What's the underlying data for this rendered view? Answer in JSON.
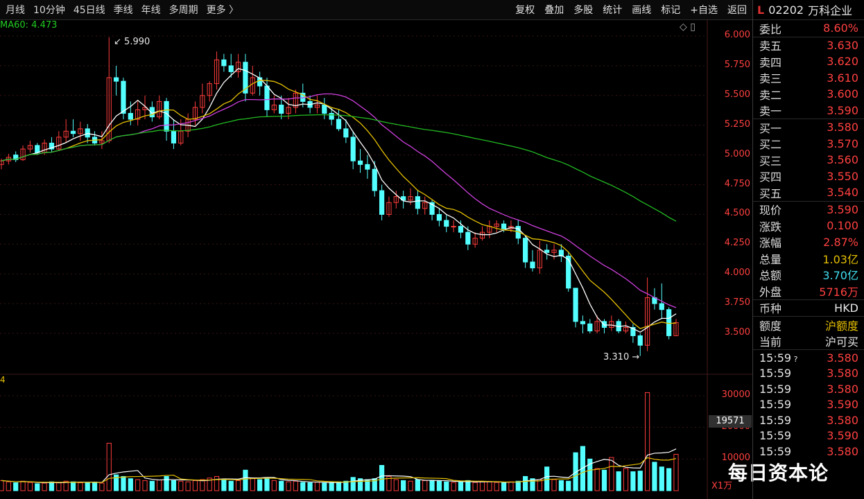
{
  "toolbar": {
    "left_items": [
      "月线",
      "10分钟",
      "45日线",
      "季线",
      "年线",
      "多周期",
      "更多 〉"
    ],
    "right_items": [
      "复权",
      "叠加",
      "多股",
      "统计",
      "画线",
      "标记",
      "+自选",
      "返回"
    ]
  },
  "ma_label": "MA60: 4.473",
  "annotations": {
    "high": "5.990",
    "low": "3.310"
  },
  "watermark": "每日资本论",
  "volume_unit": "X1万",
  "volume_badge": "19571",
  "stock": {
    "code": "02202",
    "name": "万科企业",
    "mark": "L"
  },
  "quote": {
    "weibi": {
      "label": "委比",
      "value": "8.60%"
    },
    "asks": [
      {
        "label": "卖五",
        "value": "3.630"
      },
      {
        "label": "卖四",
        "value": "3.620"
      },
      {
        "label": "卖三",
        "value": "3.610"
      },
      {
        "label": "卖二",
        "value": "3.600"
      },
      {
        "label": "卖一",
        "value": "3.590"
      }
    ],
    "bids": [
      {
        "label": "买一",
        "value": "3.580"
      },
      {
        "label": "买二",
        "value": "3.570"
      },
      {
        "label": "买三",
        "value": "3.560"
      },
      {
        "label": "买四",
        "value": "3.550"
      },
      {
        "label": "买五",
        "value": "3.540"
      }
    ],
    "stats": [
      {
        "label": "现价",
        "value": "3.590",
        "color": "red"
      },
      {
        "label": "涨跌",
        "value": "0.100",
        "color": "red"
      },
      {
        "label": "涨幅",
        "value": "2.87%",
        "color": "red"
      },
      {
        "label": "总量",
        "value": "1.03亿",
        "color": "yellow"
      },
      {
        "label": "总额",
        "value": "3.70亿",
        "color": "cyan"
      },
      {
        "label": "外盘",
        "value": "5716万",
        "color": "red"
      }
    ],
    "currency": {
      "label": "币种",
      "value": "HKD"
    },
    "quota": {
      "label": "额度",
      "value": "沪额度"
    },
    "current": {
      "label": "当前",
      "value": "沪可买"
    }
  },
  "ticks": [
    {
      "time": "15:59",
      "flag": "?",
      "price": "3.580"
    },
    {
      "time": "15:59",
      "flag": "",
      "price": "3.580"
    },
    {
      "time": "15:59",
      "flag": "",
      "price": "3.580"
    },
    {
      "time": "15:59",
      "flag": "",
      "price": "3.590"
    },
    {
      "time": "15:59",
      "flag": "",
      "price": "3.580"
    },
    {
      "time": "15:59",
      "flag": "",
      "price": "3.590"
    },
    {
      "time": "15:59",
      "flag": "",
      "price": "3.580"
    }
  ],
  "chart_data": {
    "type": "candlestick",
    "price_axis": {
      "ticks": [
        "6.000",
        "5.750",
        "5.500",
        "5.250",
        "5.000",
        "4.750",
        "4.500",
        "4.250",
        "4.000",
        "3.750",
        "3.500"
      ],
      "range": [
        3.3,
        6.05
      ]
    },
    "volume_axis": {
      "ticks": [
        "30000",
        "20000",
        "10000"
      ],
      "range": [
        0,
        32000
      ]
    },
    "candles": [
      [
        4.92,
        4.95,
        4.88,
        4.97
      ],
      [
        4.95,
        4.98,
        4.92,
        5.01
      ],
      [
        5.0,
        4.96,
        4.94,
        5.03
      ],
      [
        4.96,
        5.05,
        4.95,
        5.08
      ],
      [
        5.05,
        5.08,
        5.02,
        5.12
      ],
      [
        5.08,
        5.02,
        5.0,
        5.1
      ],
      [
        5.02,
        5.1,
        5.0,
        5.13
      ],
      [
        5.1,
        5.05,
        5.02,
        5.15
      ],
      [
        5.05,
        5.15,
        5.04,
        5.2
      ],
      [
        5.15,
        5.2,
        5.1,
        5.3
      ],
      [
        5.2,
        5.18,
        5.15,
        5.3
      ],
      [
        5.18,
        5.22,
        5.12,
        5.28
      ],
      [
        5.22,
        5.15,
        5.1,
        5.26
      ],
      [
        5.15,
        5.1,
        5.08,
        5.2
      ],
      [
        5.1,
        5.12,
        5.05,
        5.2
      ],
      [
        5.12,
        5.65,
        5.1,
        5.99
      ],
      [
        5.65,
        5.62,
        5.5,
        5.75
      ],
      [
        5.62,
        5.35,
        5.3,
        5.65
      ],
      [
        5.35,
        5.3,
        5.25,
        5.45
      ],
      [
        5.3,
        5.38,
        5.25,
        5.45
      ],
      [
        5.38,
        5.4,
        5.3,
        5.5
      ],
      [
        5.4,
        5.32,
        5.28,
        5.45
      ],
      [
        5.32,
        5.45,
        5.3,
        5.5
      ],
      [
        5.45,
        5.2,
        5.12,
        5.48
      ],
      [
        5.2,
        5.1,
        5.05,
        5.3
      ],
      [
        5.1,
        5.2,
        5.08,
        5.3
      ],
      [
        5.2,
        5.3,
        5.15,
        5.35
      ],
      [
        5.3,
        5.4,
        5.25,
        5.45
      ],
      [
        5.4,
        5.5,
        5.35,
        5.6
      ],
      [
        5.5,
        5.6,
        5.45,
        5.62
      ],
      [
        5.6,
        5.8,
        5.55,
        5.87
      ],
      [
        5.8,
        5.75,
        5.7,
        5.85
      ],
      [
        5.75,
        5.7,
        5.65,
        5.85
      ],
      [
        5.7,
        5.78,
        5.65,
        5.85
      ],
      [
        5.78,
        5.52,
        5.45,
        5.85
      ],
      [
        5.52,
        5.65,
        5.5,
        5.75
      ],
      [
        5.65,
        5.58,
        5.5,
        5.7
      ],
      [
        5.58,
        5.38,
        5.32,
        5.65
      ],
      [
        5.38,
        5.42,
        5.35,
        5.5
      ],
      [
        5.42,
        5.35,
        5.3,
        5.5
      ],
      [
        5.35,
        5.4,
        5.3,
        5.48
      ],
      [
        5.4,
        5.52,
        5.35,
        5.55
      ],
      [
        5.52,
        5.45,
        5.4,
        5.6
      ],
      [
        5.45,
        5.4,
        5.35,
        5.5
      ],
      [
        5.4,
        5.42,
        5.35,
        5.5
      ],
      [
        5.42,
        5.35,
        5.3,
        5.48
      ],
      [
        5.35,
        5.3,
        5.25,
        5.4
      ],
      [
        5.3,
        5.22,
        5.2,
        5.38
      ],
      [
        5.22,
        5.15,
        5.1,
        5.3
      ],
      [
        5.15,
        4.95,
        4.88,
        5.2
      ],
      [
        4.95,
        4.92,
        4.85,
        5.05
      ],
      [
        4.92,
        4.88,
        4.8,
        5.0
      ],
      [
        4.88,
        4.7,
        4.65,
        4.95
      ],
      [
        4.7,
        4.5,
        4.45,
        4.75
      ],
      [
        4.5,
        4.6,
        4.48,
        4.65
      ],
      [
        4.6,
        4.65,
        4.55,
        4.7
      ],
      [
        4.65,
        4.62,
        4.55,
        4.7
      ],
      [
        4.62,
        4.65,
        4.58,
        4.72
      ],
      [
        4.65,
        4.55,
        4.5,
        4.7
      ],
      [
        4.55,
        4.6,
        4.5,
        4.65
      ],
      [
        4.6,
        4.5,
        4.45,
        4.62
      ],
      [
        4.5,
        4.45,
        4.4,
        4.55
      ],
      [
        4.45,
        4.4,
        4.35,
        4.5
      ],
      [
        4.4,
        4.4,
        4.35,
        4.45
      ],
      [
        4.4,
        4.35,
        4.3,
        4.45
      ],
      [
        4.35,
        4.25,
        4.2,
        4.4
      ],
      [
        4.25,
        4.3,
        4.22,
        4.35
      ],
      [
        4.3,
        4.35,
        4.28,
        4.4
      ],
      [
        4.35,
        4.4,
        4.3,
        4.45
      ],
      [
        4.4,
        4.42,
        4.35,
        4.45
      ],
      [
        4.42,
        4.38,
        4.35,
        4.45
      ],
      [
        4.38,
        4.4,
        4.35,
        4.45
      ],
      [
        4.4,
        4.3,
        4.25,
        4.45
      ],
      [
        4.3,
        4.1,
        4.05,
        4.32
      ],
      [
        4.1,
        4.05,
        4.02,
        4.2
      ],
      [
        4.05,
        4.2,
        4.0,
        4.28
      ],
      [
        4.2,
        4.18,
        4.12,
        4.25
      ],
      [
        4.18,
        4.2,
        4.12,
        4.25
      ],
      [
        4.2,
        4.15,
        4.1,
        4.25
      ],
      [
        4.15,
        3.88,
        3.85,
        4.18
      ],
      [
        3.88,
        3.6,
        3.55,
        3.75
      ],
      [
        3.6,
        3.58,
        3.5,
        3.65
      ],
      [
        3.58,
        3.52,
        3.5,
        3.62
      ],
      [
        3.52,
        3.6,
        3.5,
        3.65
      ],
      [
        3.6,
        3.55,
        3.5,
        3.62
      ],
      [
        3.55,
        3.6,
        3.52,
        3.65
      ],
      [
        3.6,
        3.52,
        3.5,
        3.62
      ],
      [
        3.52,
        3.55,
        3.5,
        3.6
      ],
      [
        3.55,
        3.48,
        3.42,
        3.58
      ],
      [
        3.48,
        3.4,
        3.31,
        3.5
      ],
      [
        3.4,
        3.8,
        3.35,
        3.97
      ],
      [
        3.8,
        3.75,
        3.7,
        3.88
      ],
      [
        3.75,
        3.7,
        3.62,
        3.92
      ],
      [
        3.7,
        3.48,
        3.45,
        3.72
      ],
      [
        3.48,
        3.59,
        3.48,
        3.62
      ]
    ],
    "volumes": [
      3200,
      2800,
      2500,
      3000,
      2600,
      2200,
      2400,
      2800,
      2500,
      3000,
      2800,
      2500,
      2600,
      2700,
      2400,
      15000,
      5000,
      4500,
      3800,
      3500,
      3200,
      3000,
      3400,
      4500,
      3200,
      3000,
      2800,
      3200,
      3500,
      4000,
      4500,
      3500,
      3000,
      3200,
      6500,
      4000,
      3500,
      3800,
      3200,
      3000,
      2800,
      3000,
      2600,
      2500,
      2700,
      2400,
      2600,
      2800,
      3000,
      4200,
      3800,
      3500,
      3800,
      8000,
      4500,
      3500,
      3200,
      3000,
      3500,
      3200,
      3300,
      3000,
      2800,
      2600,
      2800,
      3200,
      2600,
      2800,
      2800,
      2600,
      2500,
      2800,
      3000,
      4500,
      3800,
      3500,
      7500,
      3500,
      3200,
      3000,
      12000,
      14000,
      10000,
      7000,
      6500,
      10500,
      6000,
      7000,
      6000,
      6200,
      31000,
      9000,
      7500,
      7000,
      11500
    ],
    "high_label": "5.990",
    "low_label": "3.310"
  }
}
